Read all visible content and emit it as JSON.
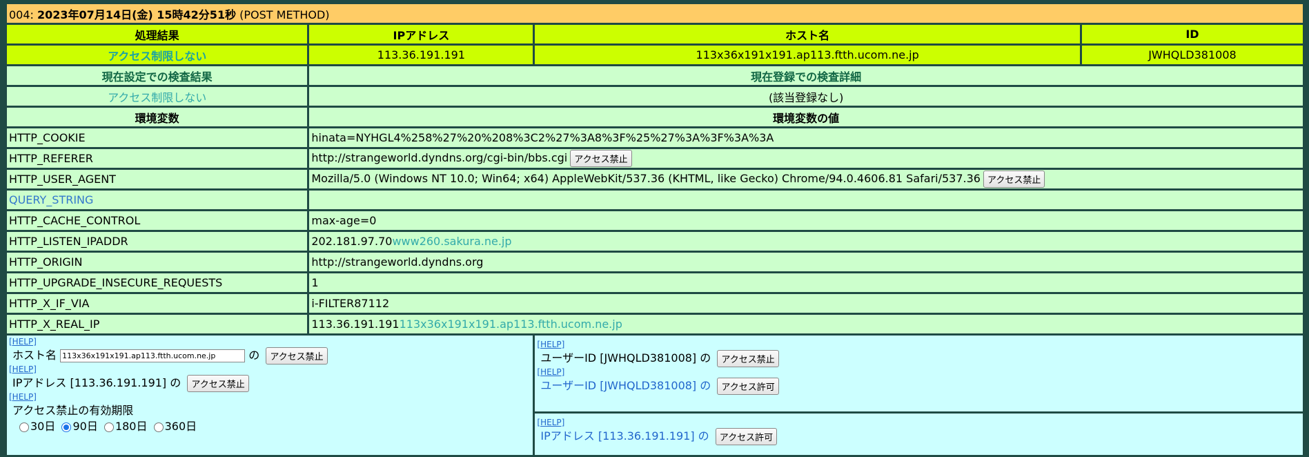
{
  "title": {
    "prefix": "004: ",
    "datetime": "2023年07月14日(金) 15時42分51秒",
    "method": " (POST METHOD)"
  },
  "headers": [
    "処理結果",
    "IPアドレス",
    "ホスト名",
    "ID"
  ],
  "result": {
    "status": "アクセス制限しない",
    "ip": "113.36.191.191",
    "host": "113x36x191x191.ap113.ftth.ucom.ne.jp",
    "id": "JWHQLD381008"
  },
  "check": {
    "current_setting_label": "現在設定での検査結果",
    "current_detail_label": "現在登録での検査詳細",
    "current_setting_value": "アクセス制限しない",
    "current_detail_value": "(該当登録なし)"
  },
  "env_headers": {
    "name": "環境変数",
    "value": "環境変数の値"
  },
  "env": [
    {
      "name": "HTTP_COOKIE",
      "value": "hinata=NYHGL4%258%27%20%208%3C2%27%3A8%3F%25%27%3A%3F%3A%3A",
      "extra": "",
      "button": ""
    },
    {
      "name": "HTTP_REFERER",
      "value": "http://strangeworld.dyndns.org/cgi-bin/bbs.cgi",
      "extra": "",
      "button": "アクセス禁止"
    },
    {
      "name": "HTTP_USER_AGENT",
      "value": "Mozilla/5.0 (Windows NT 10.0; Win64; x64) AppleWebKit/537.36 (KHTML, like Gecko) Chrome/94.0.4606.81 Safari/537.36",
      "extra": "",
      "button": "アクセス禁止"
    },
    {
      "name": "QUERY_STRING",
      "value": "",
      "extra": "",
      "button": ""
    },
    {
      "name": "HTTP_CACHE_CONTROL",
      "value": "max-age=0",
      "extra": "",
      "button": ""
    },
    {
      "name": "HTTP_LISTEN_IPADDR",
      "value": "202.181.97.70",
      "extra": "www260.sakura.ne.jp",
      "button": ""
    },
    {
      "name": "HTTP_ORIGIN",
      "value": "http://strangeworld.dyndns.org",
      "extra": "",
      "button": ""
    },
    {
      "name": "HTTP_UPGRADE_INSECURE_REQUESTS",
      "value": "1",
      "extra": "",
      "button": ""
    },
    {
      "name": "HTTP_X_IF_VIA",
      "value": "i-FILTER87112",
      "extra": "",
      "button": ""
    },
    {
      "name": "HTTP_X_REAL_IP",
      "value": "113.36.191.191",
      "extra": "113x36x191x191.ap113.ftth.ucom.ne.jp",
      "button": ""
    }
  ],
  "actions": {
    "help": "[HELP]",
    "host_label": "ホスト名",
    "host_value": "113x36x191x191.ap113.ftth.ucom.ne.jp",
    "no": "の",
    "ban": "アクセス禁止",
    "allow": "アクセス許可",
    "ip_label": "IPアドレス [113.36.191.191] の",
    "period_label": "アクセス禁止の有効期限",
    "periods": [
      "30日",
      "90日",
      "180日",
      "360日"
    ],
    "user_ban_label": "ユーザーID [JWHQLD381008] の",
    "user_allow_label": "ユーザーID [JWHQLD381008] の",
    "ip_allow_label": "IPアドレス [113.36.191.191] の"
  }
}
